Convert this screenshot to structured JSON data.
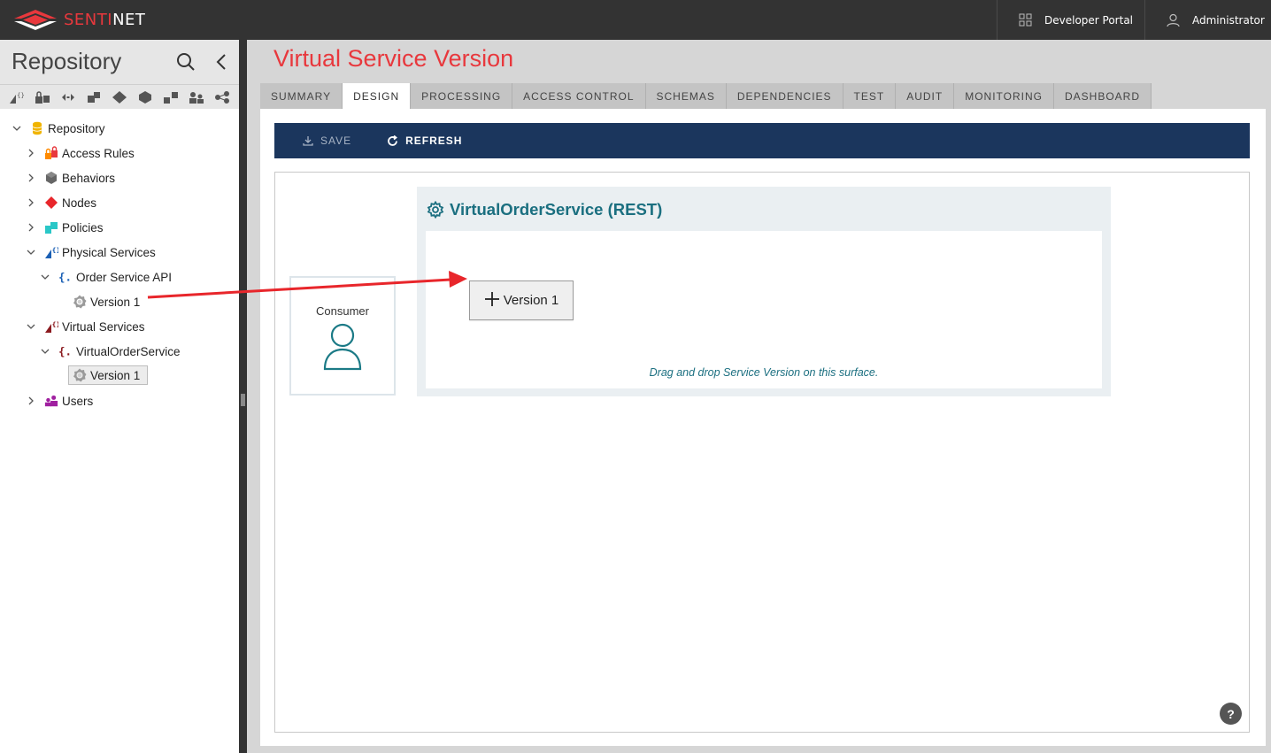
{
  "app": {
    "logo_prefix": "SENTI",
    "logo_suffix": "NET",
    "brand_color": "#e8383d",
    "topbar_color": "#333333"
  },
  "topbar": {
    "developer_portal": "Developer Portal",
    "user": "Administrator"
  },
  "sidebar": {
    "title": "Repository",
    "toolbar_icons": [
      "physical-service-icon",
      "access-rule-icon",
      "diagram-icon",
      "nodes-icon",
      "policies-icon",
      "behaviors-icon",
      "hierarchy-icon",
      "users-icon",
      "sharing-icon"
    ],
    "tree": [
      {
        "label": "Repository",
        "icon": "database-icon",
        "expanded": true
      },
      {
        "label": "Access Rules",
        "icon": "access-rules-icon",
        "expanded": false
      },
      {
        "label": "Behaviors",
        "icon": "behaviors-icon",
        "expanded": false
      },
      {
        "label": "Nodes",
        "icon": "nodes-icon",
        "expanded": false
      },
      {
        "label": "Policies",
        "icon": "policies-icon",
        "expanded": false
      },
      {
        "label": "Physical Services",
        "icon": "physical-services-icon",
        "expanded": true
      },
      {
        "label": "Order Service API",
        "icon": "api-braces-icon",
        "expanded": true
      },
      {
        "label": "Version 1",
        "icon": "gear-icon"
      },
      {
        "label": "Virtual Services",
        "icon": "virtual-services-icon",
        "expanded": true
      },
      {
        "label": "VirtualOrderService",
        "icon": "virtual-braces-icon",
        "expanded": true
      },
      {
        "label": "Version 1",
        "icon": "gear-icon",
        "selected": true
      },
      {
        "label": "Users",
        "icon": "users-icon",
        "expanded": false
      }
    ]
  },
  "main": {
    "title": "Virtual Service Version",
    "tabs": [
      "SUMMARY",
      "DESIGN",
      "PROCESSING",
      "ACCESS CONTROL",
      "SCHEMAS",
      "DEPENDENCIES",
      "TEST",
      "AUDIT",
      "MONITORING",
      "DASHBOARD"
    ],
    "active_tab": "DESIGN",
    "toolbar": {
      "save": "SAVE",
      "refresh": "REFRESH",
      "color": "#1b365d"
    },
    "designer": {
      "consumer_label": "Consumer",
      "service_title": "VirtualOrderService (REST)",
      "version_button": "Version 1",
      "drop_hint": "Drag and drop Service Version on this surface.",
      "accent_color": "#1b6f80",
      "arrow_color": "#e8262b"
    },
    "help": "?"
  }
}
